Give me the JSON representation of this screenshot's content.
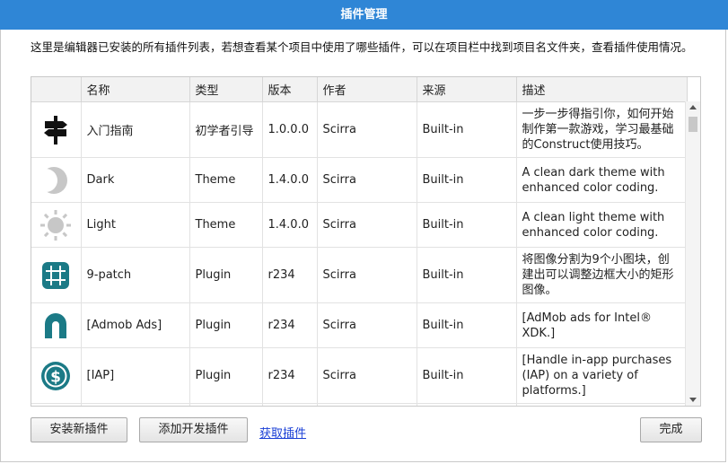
{
  "window": {
    "title": "插件管理"
  },
  "intro": "这里是编辑器已安装的所有插件列表，若想查看某个项目中使用了哪些插件，可以在项目栏中找到项目名文件夹，查看插件使用情况。",
  "columns": [
    "",
    "名称",
    "类型",
    "版本",
    "作者",
    "来源",
    "描述"
  ],
  "plugins": [
    {
      "icon": "signpost-icon",
      "name": "入门指南",
      "type": "初学者引导",
      "version": "1.0.0.0",
      "author": "Scirra",
      "source": "Built-in",
      "description": "一步一步得指引你，如何开始制作第一款游戏，学习最基础的Construct使用技巧。"
    },
    {
      "icon": "moon-icon",
      "name": "Dark",
      "type": "Theme",
      "version": "1.4.0.0",
      "author": "Scirra",
      "source": "Built-in",
      "description": "A clean dark theme with enhanced color coding."
    },
    {
      "icon": "sun-icon",
      "name": "Light",
      "type": "Theme",
      "version": "1.4.0.0",
      "author": "Scirra",
      "source": "Built-in",
      "description": "A clean light theme with enhanced color coding."
    },
    {
      "icon": "nine-patch-icon",
      "name": "9-patch",
      "type": "Plugin",
      "version": "r234",
      "author": "Scirra",
      "source": "Built-in",
      "description": "将图像分割为9个小图块，创建出可以调整边框大小的矩形图像。"
    },
    {
      "icon": "admob-icon",
      "name": "[Admob Ads]",
      "type": "Plugin",
      "version": "r234",
      "author": "Scirra",
      "source": "Built-in",
      "description": "[AdMob ads for Intel® XDK.]"
    },
    {
      "icon": "dollar-coin-icon",
      "name": "[IAP]",
      "type": "Plugin",
      "version": "r234",
      "author": "Scirra",
      "source": "Built-in",
      "description": "[Handle in-app purchases (IAP) on a variety of platforms.]"
    }
  ],
  "buttons": {
    "install": "安装新插件",
    "add_dev": "添加开发插件",
    "get_plugins": "获取插件",
    "done": "完成"
  },
  "colors": {
    "titlebar": "#2f86d6",
    "icon_teal": "#1b7a86",
    "link": "#1a3fd6"
  }
}
